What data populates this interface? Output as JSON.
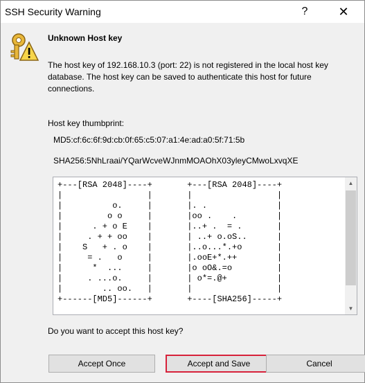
{
  "window": {
    "title": "SSH Security Warning",
    "help_glyph": "?",
    "close_glyph": "✕"
  },
  "dialog": {
    "heading": "Unknown Host key",
    "message": "The host key of 192.168.10.3 (port: 22) is not registered in the local host key database. The host key can be saved to authenticate this host for future connections.",
    "thumbprint_label": "Host key thumbprint:",
    "md5": "MD5:cf:6c:6f:9d:cb:0f:65:c5:07:a1:4e:ad:a0:5f:71:5b",
    "sha256": "SHA256:5NhLraai/YQarWcveWJnmMOAOhX03yleyCMwoLxvqXE",
    "randomart": "+---[RSA 2048]----+       +---[RSA 2048]----+\n|                 |       |                 |\n|          o.     |       |. .              |\n|         o o     |       |oo .    .        |\n|      . + o E    |       |..+ .  = .       |\n|     . + + oo    |       | ..+ o.oS..      |\n|    S   + . o    |       |..o...*.+o       |\n|     = .   o     |       |.ooE+*.++        |\n|      *  ...     |       |o oO&.=o         |\n|     . ...o.     |       | o*=.@+          |\n|        .. oo.   |       |                 |\n+------[MD5]------+       +----[SHA256]-----+",
    "question": "Do you want to accept this host key?"
  },
  "buttons": {
    "accept_once": "Accept Once",
    "accept_save": "Accept and Save",
    "cancel": "Cancel"
  },
  "colors": {
    "default_button_border": "#d7213a",
    "background": "#f0f0f0"
  },
  "icons": {
    "warning": "key-warning-icon"
  }
}
